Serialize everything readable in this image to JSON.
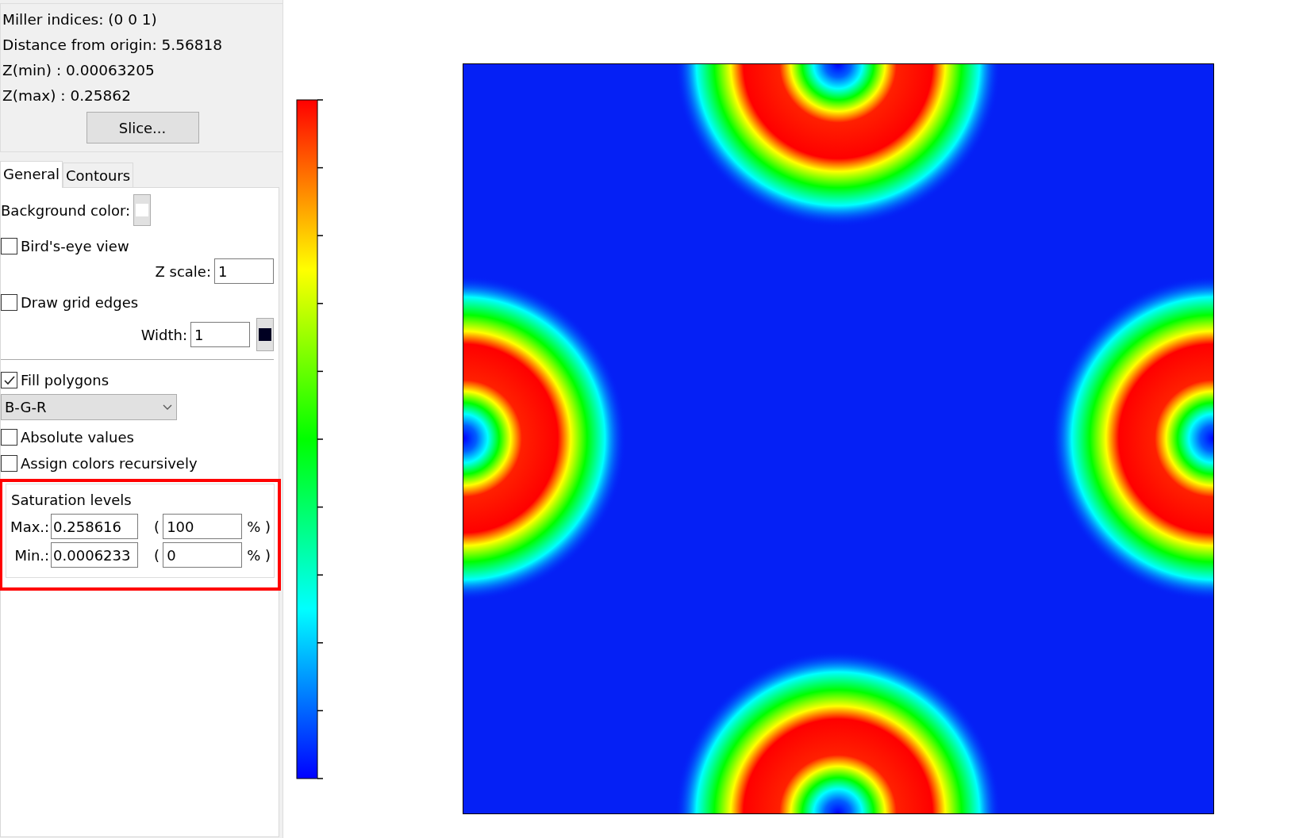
{
  "info": [
    "Miller indices: (0 0 1)",
    "Distance from origin: 5.56818",
    "Z(min) : 0.00063205",
    "Z(max) : 0.25862"
  ],
  "slice_button": "Slice...",
  "tabs": [
    {
      "label": "General",
      "selected": true
    },
    {
      "label": "Contours",
      "selected": false
    }
  ],
  "background_color": {
    "label": "Background color:",
    "color": "#ffffff"
  },
  "birds_eye": {
    "label": "Bird's-eye view",
    "checked": false
  },
  "z_scale": {
    "label": "Z scale:",
    "value": "1"
  },
  "grid_edges": {
    "label": "Draw grid edges",
    "checked": false
  },
  "width": {
    "label": "Width:",
    "value": "1",
    "color": "#000022"
  },
  "fill_polygons": {
    "label": "Fill polygons",
    "checked": true
  },
  "palette": {
    "value": "B-G-R"
  },
  "absolute_values": {
    "label": "Absolute values",
    "checked": false
  },
  "assign_recursively": {
    "label": "Assign colors recursively",
    "checked": false
  },
  "saturation": {
    "title": "Saturation levels",
    "rows": [
      {
        "label": "Max.:",
        "value": "0.258616",
        "open": "(",
        "percent": "100",
        "close": "% )"
      },
      {
        "label": "Min.:",
        "value": "0.0006233",
        "open": "(",
        "percent": "0",
        "close": "% )"
      }
    ]
  }
}
